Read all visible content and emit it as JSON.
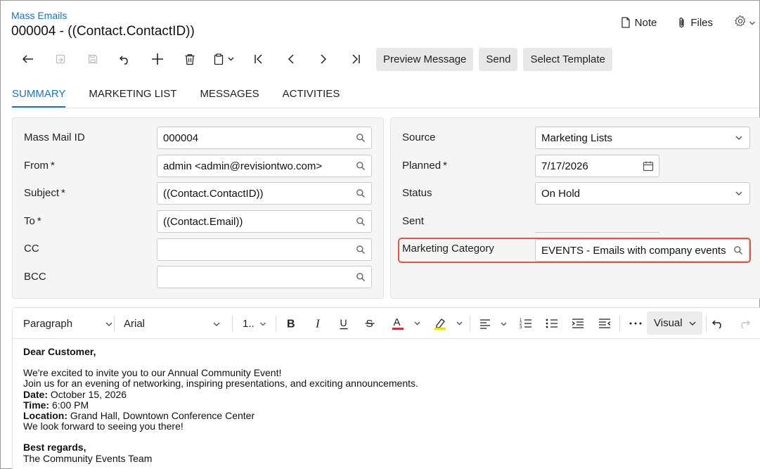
{
  "header": {
    "breadcrumb": "Mass Emails",
    "title": "000004 - ((Contact.ContactID))",
    "note_label": "Note",
    "files_label": "Files"
  },
  "toolbar": {
    "icons": [
      "back-arrow-icon",
      "copy-paste-icon",
      "save-icon",
      "undo-icon",
      "add-icon",
      "delete-icon",
      "clipboard-icon",
      "first-record-icon",
      "previous-record-icon",
      "next-record-icon",
      "last-record-icon"
    ],
    "preview_label": "Preview Message",
    "send_label": "Send",
    "select_template_label": "Select Template"
  },
  "tabs": [
    {
      "label": "SUMMARY",
      "active": true
    },
    {
      "label": "MARKETING LIST",
      "active": false
    },
    {
      "label": "MESSAGES",
      "active": false
    },
    {
      "label": "ACTIVITIES",
      "active": false
    }
  ],
  "left_form": {
    "mass_mail_id": {
      "label": "Mass Mail ID",
      "value": "000004"
    },
    "from": {
      "label": "From",
      "required": "*",
      "value": "admin <admin@revisiontwo.com>"
    },
    "subject": {
      "label": "Subject",
      "required": "*",
      "value": "((Contact.ContactID))"
    },
    "to": {
      "label": "To",
      "required": "*",
      "value": "((Contact.Email))"
    },
    "cc": {
      "label": "CC",
      "value": ""
    },
    "bcc": {
      "label": "BCC",
      "value": ""
    }
  },
  "right_form": {
    "source": {
      "label": "Source",
      "value": "Marketing Lists"
    },
    "planned": {
      "label": "Planned",
      "required": "*",
      "value": "7/17/2026"
    },
    "status": {
      "label": "Status",
      "value": "On Hold"
    },
    "sent": {
      "label": "Sent",
      "value": ""
    },
    "marketing_category": {
      "label": "Marketing Category",
      "value": "EVENTS - Emails with company events"
    }
  },
  "editor_toolbar": {
    "paragraph": "Paragraph",
    "font": "Arial",
    "size": "1..",
    "mode": "Visual"
  },
  "email_body": {
    "greeting": "Dear Customer,",
    "line1": "We're excited to invite you to our Annual Community Event!",
    "line2": "Join us for an evening of networking, inspiring presentations, and exciting announcements.",
    "date_label": "Date:",
    "date_value": " October 15, 2026",
    "time_label": "Time:",
    "time_value": " 6:00 PM",
    "location_label": "Location:",
    "location_value": " Grand Hall, Downtown Conference Center",
    "line3": "We look forward to seeing you there!",
    "closing": "Best regards,",
    "signature": "The Community Events Team"
  },
  "colors": {
    "accent": "#1a73c8",
    "highlight_border": "#e0583e",
    "font_color_bar": "#d32f2f",
    "highlight_color_bar": "#f5e000"
  }
}
